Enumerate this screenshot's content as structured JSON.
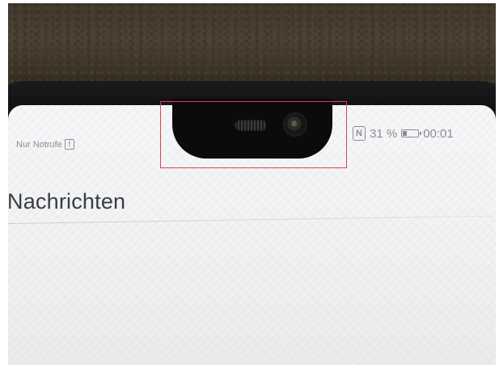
{
  "status_bar": {
    "left_text": "Nur Notrufe",
    "alert_glyph": "!",
    "nfc_glyph": "N",
    "battery_text": "31 %",
    "battery_level": 0.31,
    "time": "00:01"
  },
  "app": {
    "title": "Nachrichten"
  },
  "colors": {
    "highlight": "#d9444c",
    "status_text": "#8a8d90"
  },
  "icons": [
    "alert-icon",
    "nfc-icon",
    "battery-icon"
  ]
}
